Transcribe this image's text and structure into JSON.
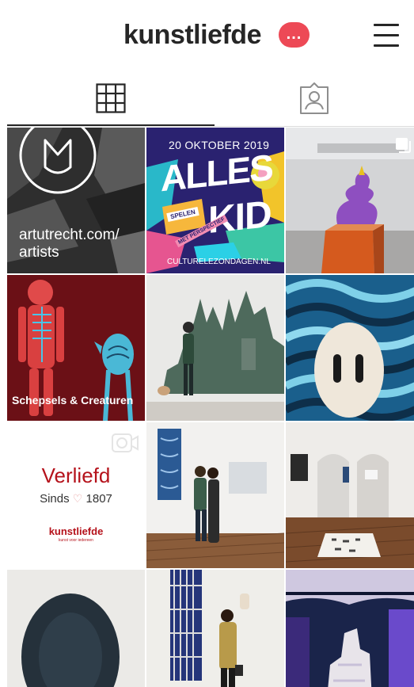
{
  "profile": {
    "username": "kunstliefde",
    "notification_badge": "..."
  },
  "tabs": [
    {
      "name": "grid",
      "icon": "grid-icon",
      "active": true
    },
    {
      "name": "tagged",
      "icon": "tagged-person-icon",
      "active": false
    }
  ],
  "posts": [
    {
      "index": 1,
      "text_line1": "artutrecht.com/",
      "text_line2": "artists"
    },
    {
      "index": 2,
      "date": "20 OKTOBER 2019",
      "title_part1": "ALLES",
      "title_part2": "KID",
      "sticker1": "SPELEN",
      "sticker2": "MET PERSPECTIEF",
      "url": "CULTURELEZONDAGEN.NL"
    },
    {
      "index": 3,
      "multi_icon": "carousel-icon"
    },
    {
      "index": 4,
      "caption": "Schepsels & Creaturen"
    },
    {
      "index": 5
    },
    {
      "index": 6
    },
    {
      "index": 7,
      "video_icon": "video-icon",
      "title": "Verliefd",
      "since_label": "Sinds",
      "year": "1807",
      "brand": "kunstliefde",
      "brand_tagline": "kunst voor iedereen"
    },
    {
      "index": 8
    },
    {
      "index": 9
    },
    {
      "index": 10
    },
    {
      "index": 11
    },
    {
      "index": 12
    }
  ],
  "colors": {
    "accent_red": "#ed4956",
    "text_dark": "#262626",
    "divider": "#dbdbdb"
  }
}
